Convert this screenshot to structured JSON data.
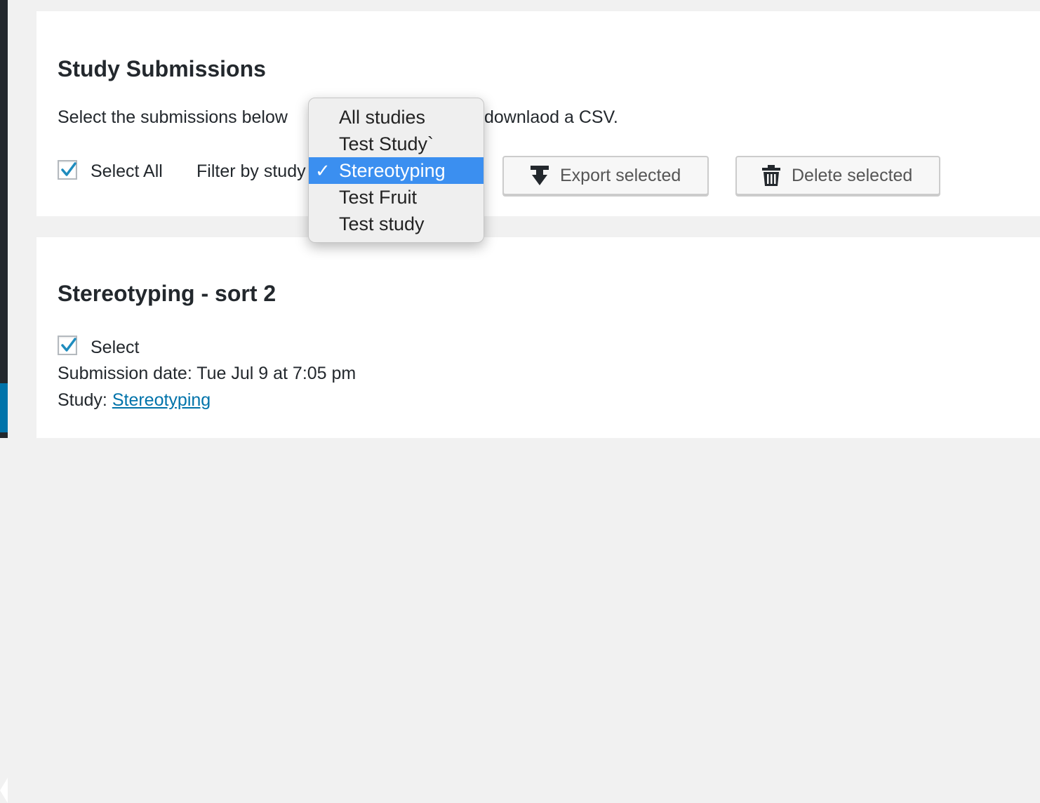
{
  "page": {
    "heading": "Study Submissions",
    "instructions": "Select the submissions below",
    "instructions_tail": "downlaod a CSV.",
    "select_all_label": "Select All",
    "filter_label": "Filter by study",
    "select_all_checked": true
  },
  "filter_dropdown": {
    "options": [
      "All studies",
      "Test Study`",
      "Stereotyping",
      "Test Fruit",
      "Test study"
    ],
    "selected": "Stereotyping",
    "check_mark": "✓"
  },
  "toolbar": {
    "export_label": "Export selected",
    "export_icon": "download-icon",
    "delete_label": "Delete selected",
    "delete_icon": "trash-icon"
  },
  "submission": {
    "title": "Stereotyping - sort 2",
    "select_label": "Select",
    "select_checked": true,
    "date_label": "Submission date:",
    "date_value": "Tue Jul 9 at 7:05 pm",
    "study_label": "Study:",
    "study_link": "Stereotyping"
  },
  "colors": {
    "accent": "#0073aa",
    "dropdown_highlight": "#3b8ff0",
    "checkmark": "#1e8cbe"
  }
}
